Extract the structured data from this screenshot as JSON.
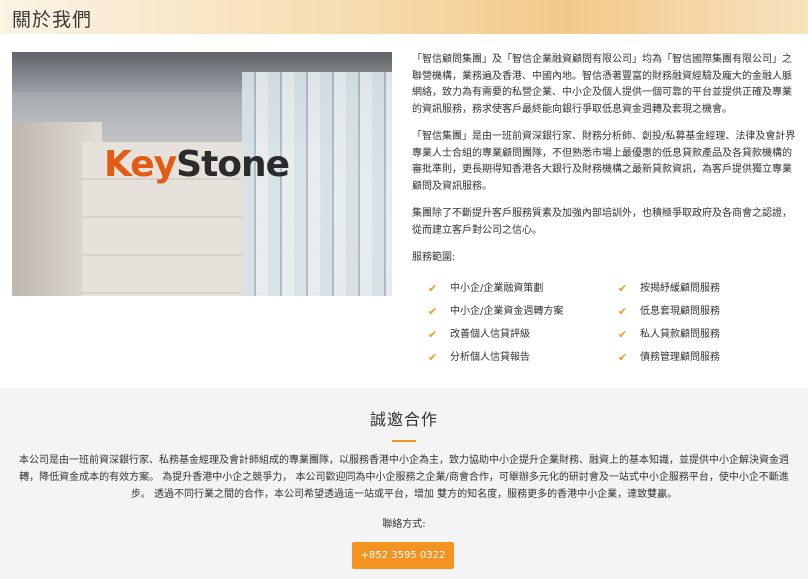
{
  "header": {
    "title": "關於我們"
  },
  "photo": {
    "logo_key": "Key",
    "logo_stone": "Stone"
  },
  "intro": {
    "p1": "「智信顧問集團」及「智信企業融資顧問有限公司」均為「智信國際集團有限公司」之聯營機構，業務遍及香港、中國內地。智信憑著豐富的財務融資經驗及龐大的金融人脈網絡，致力為有需要的私營企業、中小企及個人提供一個可靠的平台並提供正確及專業的資訊服務，務求使客戶最終能向銀行爭取低息資金週轉及套現之機會。",
    "p2": "「智信集團」是由一班前資深銀行家、財務分析師、創投/私募基金經理、法律及會計界專業人士合組的專業顧問團隊，不但熟悉市場上最優惠的低息貸款產品及各貸款機構的審批準則，更長期得知香港各大銀行及財務機構之最新貸款資訊，為客戶提供獨立專業顧問及資訊服務。",
    "p3": "集團除了不斷提升客戶服務質素及加強內部培訓外，也積極爭取政府及各商會之認證，從而建立客戶對公司之信心。",
    "scope_label": "服務範圍:"
  },
  "services": {
    "left": [
      "中小企/企業融資策劃",
      "中小企/企業資金週轉方案",
      "改善個人信貸評級",
      "分析個人信貸報告"
    ],
    "right": [
      "按揭紓緩顧問服務",
      "低息套現顧問服務",
      "私人貸款顧問服務",
      "債務管理顧問服務"
    ],
    "check_icon": "✔"
  },
  "cooperation": {
    "title": "誠邀合作",
    "line1": "本公司是由一班前資深銀行家、私務基金經理及會計師組成的專業團隊，以服務香港中小企為主，致力協助中小企提升企業財務、融資上的基本知識，並提供中小企解決資金週",
    "line2": "轉，降低資金成本的有效方案。 為提升香港中小企之競爭力， 本公司歡迎同為中小企服務之企業/商會合作，可舉辦多元化的研討會及一站式中小企服務平台，使中小企不斷進",
    "line3": "步。 透過不同行業之間的合作，本公司希望透過這一站或平台，增加 雙方的知名度，服務更多的香港中小企業，達致雙贏。",
    "contact_label": "聯絡方式:",
    "phone": "+852 3595 0322"
  },
  "colors": {
    "accent": "#f39322",
    "check": "#f29b1d",
    "logo_orange": "#e35b12"
  }
}
